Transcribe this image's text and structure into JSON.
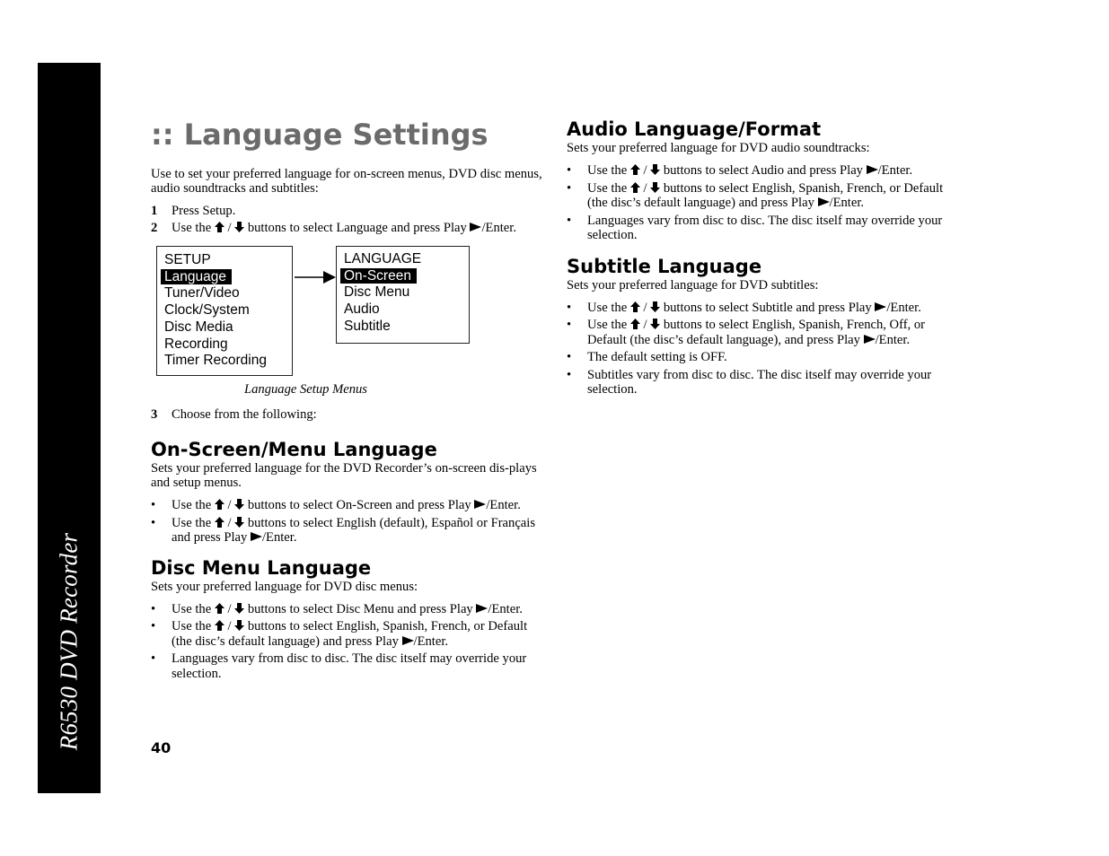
{
  "sidebar": {
    "title": "R6530 DVD Recorder"
  },
  "page_number": "40",
  "left": {
    "title": ":: Language Settings",
    "intro": "Use to set your preferred language for on-screen menus, DVD disc menus, audio soundtracks and subtitles:",
    "steps": [
      {
        "num": "1",
        "text": "Press Setup."
      },
      {
        "num": "2",
        "pre": "Use the",
        "mid": "/",
        "post": "buttons to select Language and press Play",
        "end": "/Enter."
      }
    ],
    "figure": {
      "setup_menu": {
        "title": "SETUP",
        "items": [
          "Language",
          "Tuner/Video",
          "Clock/System",
          "Disc Media",
          "Recording",
          "Timer Recording"
        ],
        "selected": "Language"
      },
      "language_menu": {
        "title": "LANGUAGE",
        "items": [
          "On-Screen",
          "Disc Menu",
          "Audio",
          "Subtitle"
        ],
        "selected": "On-Screen"
      },
      "caption": "Language Setup Menus"
    },
    "step3": {
      "num": "3",
      "text": "Choose from the following:"
    },
    "onscreen": {
      "heading": "On-Screen/Menu Language",
      "desc": "Sets your preferred language for the DVD Recorder’s on-screen dis-plays and setup menus.",
      "bullets": [
        {
          "pre": "Use the",
          "mid": "/",
          "post": "buttons to select On-Screen and press Play",
          "end": "/Enter."
        },
        {
          "pre": "Use the",
          "mid": "/",
          "post": "buttons to select English (default), Español or Français and press Play",
          "end": "/Enter."
        }
      ]
    },
    "discmenu": {
      "heading": "Disc Menu Language",
      "desc": "Sets your preferred language for DVD disc menus:",
      "bullets": [
        {
          "pre": "Use the",
          "mid": "/",
          "post": "buttons to select Disc Menu and press Play",
          "end": "/Enter."
        },
        {
          "pre": "Use the",
          "mid": "/",
          "post": "buttons to select English, Spanish, French, or Default (the disc’s default language) and press Play",
          "end": "/Enter."
        },
        {
          "text": "Languages vary from disc to disc. The disc itself may override your selection."
        }
      ]
    }
  },
  "right": {
    "audio": {
      "heading": "Audio Language/Format",
      "desc": "Sets your preferred language for DVD audio soundtracks:",
      "bullets": [
        {
          "pre": "Use the",
          "mid": "/",
          "post": "buttons to select Audio and press Play",
          "end": "/Enter."
        },
        {
          "pre": "Use the",
          "mid": "/",
          "post": "buttons to select English, Spanish, French, or Default (the disc’s default language) and press Play",
          "end": "/Enter."
        },
        {
          "text": "Languages vary from disc to disc. The disc itself may override your selection."
        }
      ]
    },
    "subtitle": {
      "heading": "Subtitle Language",
      "desc": "Sets your preferred language for DVD subtitles:",
      "bullets": [
        {
          "pre": "Use the",
          "mid": "/",
          "post": "buttons to select Subtitle and press Play",
          "end": "/Enter."
        },
        {
          "pre": "Use the",
          "mid": "/",
          "post": "buttons to select English, Spanish, French, Off, or Default (the disc’s default language), and press Play",
          "end": "/Enter."
        },
        {
          "text": "The default setting is OFF."
        },
        {
          "text": "Subtitles vary from disc to disc. The disc itself may override your selection."
        }
      ]
    }
  },
  "bullet_char": "•"
}
